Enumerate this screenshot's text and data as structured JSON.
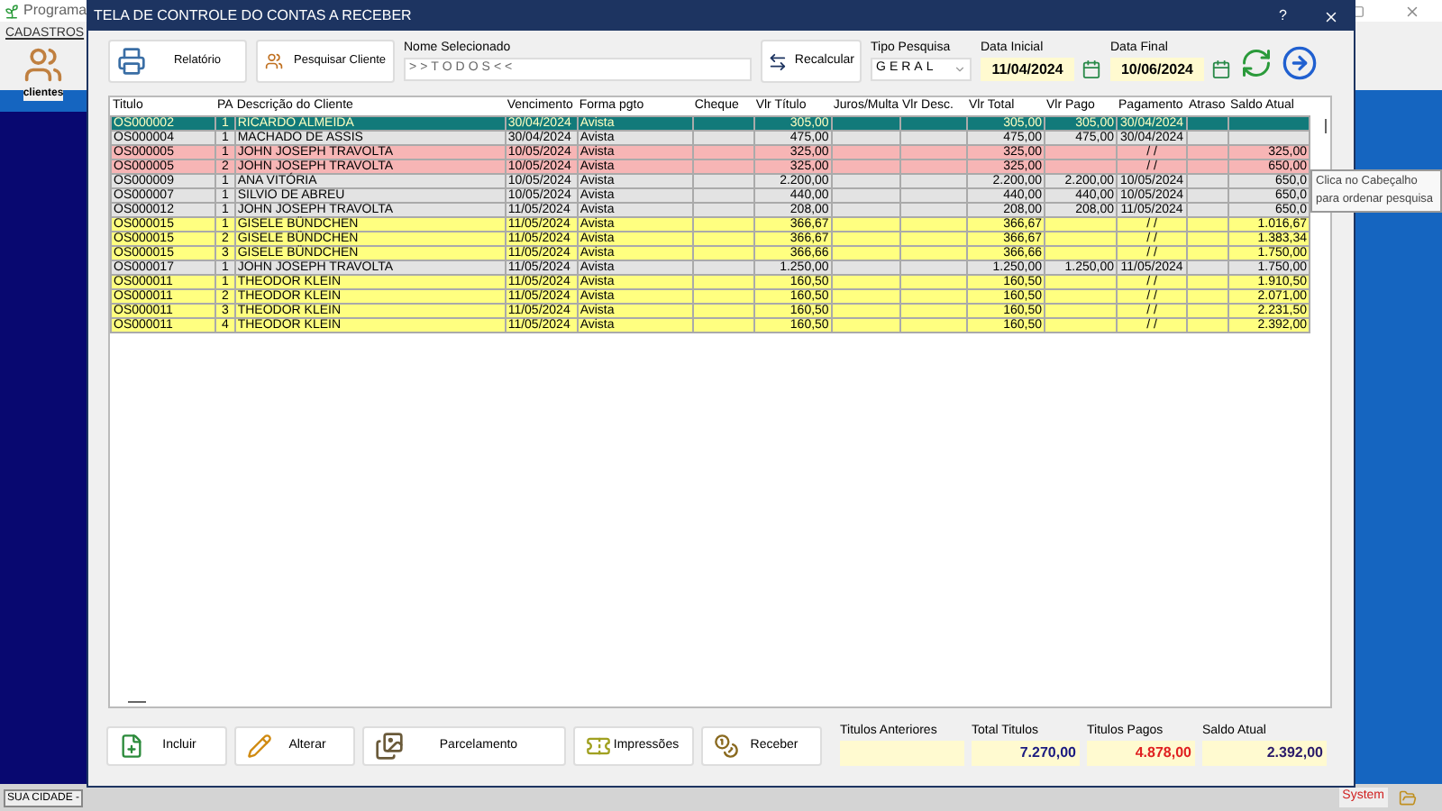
{
  "app": {
    "title": "Programa",
    "menu": [
      "CADASTROS"
    ],
    "launcher": {
      "label": "clientes"
    },
    "status_left": "SUA CIDADE -",
    "status_right": "System"
  },
  "dialog": {
    "title": "TELA DE CONTROLE DO CONTAS A RECEBER",
    "help": "?"
  },
  "toolbar": {
    "buttons": [
      {
        "label": "Relatório",
        "kind": "report"
      },
      {
        "label": "Pesquisar Cliente",
        "kind": "search"
      }
    ],
    "name_label": "Nome Selecionado",
    "name_value": ">>TODOS<<",
    "recalc": "Recalcular",
    "type_label": "Tipo Pesquisa",
    "type_value": "GERAL",
    "start_label": "Data Inicial",
    "start_value": "11/04/2024",
    "end_label": "Data Final",
    "end_value": "10/06/2024"
  },
  "table": {
    "columns": [
      "Titulo",
      "PA",
      "Descrição do Cliente",
      "Vencimento",
      "Forma pgto",
      "Cheque",
      "Vlr Título",
      "Juros/Multa",
      "Vlr Desc.",
      "Vlr Total",
      "Vlr Pago",
      "Pagamento",
      "Atraso",
      "Saldo Atual"
    ],
    "rows": [
      {
        "selected": true,
        "cells": [
          "OS000002",
          "1",
          "RICARDO ALMEIDA",
          "30/04/2024",
          "Avista",
          "",
          "305,00",
          "",
          "",
          "305,00",
          "305,00",
          "30/04/2024",
          "",
          ""
        ]
      },
      {
        "selected": false,
        "color": "#e3e3e3",
        "cells": [
          "OS000004",
          "1",
          "MACHADO DE ASSIS",
          "30/04/2024",
          "Avista",
          "",
          "475,00",
          "",
          "",
          "475,00",
          "475,00",
          "30/04/2024",
          "",
          ""
        ]
      },
      {
        "selected": false,
        "color": "#f7b5b5",
        "cells": [
          "OS000005",
          "1",
          "JOHN JOSEPH TRAVOLTA",
          "10/05/2024",
          "Avista",
          "",
          "325,00",
          "",
          "",
          "325,00",
          "",
          "/ /",
          "",
          "325,00"
        ]
      },
      {
        "selected": false,
        "color": "#f7b5b5",
        "cells": [
          "OS000005",
          "2",
          "JOHN JOSEPH TRAVOLTA",
          "10/05/2024",
          "Avista",
          "",
          "325,00",
          "",
          "",
          "325,00",
          "",
          "/ /",
          "",
          "650,00"
        ]
      },
      {
        "selected": false,
        "color": "#e3e3e3",
        "cells": [
          "OS000009",
          "1",
          "ANA VITÓRIA",
          "10/05/2024",
          "Avista",
          "",
          "2.200,00",
          "",
          "",
          "2.200,00",
          "2.200,00",
          "10/05/2024",
          "",
          "650,0"
        ]
      },
      {
        "selected": false,
        "color": "#e3e3e3",
        "cells": [
          "OS000007",
          "1",
          "SILVIO DE ABREU",
          "10/05/2024",
          "Avista",
          "",
          "440,00",
          "",
          "",
          "440,00",
          "440,00",
          "10/05/2024",
          "",
          "650,0"
        ]
      },
      {
        "selected": false,
        "color": "#e3e3e3",
        "cells": [
          "OS000012",
          "1",
          "JOHN JOSEPH TRAVOLTA",
          "11/05/2024",
          "Avista",
          "",
          "208,00",
          "",
          "",
          "208,00",
          "208,00",
          "11/05/2024",
          "",
          "650,0"
        ]
      },
      {
        "selected": false,
        "color": "#ffff80",
        "cells": [
          "OS000015",
          "1",
          "GISELE BÜNDCHEN",
          "11/05/2024",
          "Avista",
          "",
          "366,67",
          "",
          "",
          "366,67",
          "",
          "/ /",
          "",
          "1.016,67"
        ]
      },
      {
        "selected": false,
        "color": "#ffff80",
        "cells": [
          "OS000015",
          "2",
          "GISELE BÜNDCHEN",
          "11/05/2024",
          "Avista",
          "",
          "366,67",
          "",
          "",
          "366,67",
          "",
          "/ /",
          "",
          "1.383,34"
        ]
      },
      {
        "selected": false,
        "color": "#ffff80",
        "cells": [
          "OS000015",
          "3",
          "GISELE BÜNDCHEN",
          "11/05/2024",
          "Avista",
          "",
          "366,66",
          "",
          "",
          "366,66",
          "",
          "/ /",
          "",
          "1.750,00"
        ]
      },
      {
        "selected": false,
        "color": "#e3e3e3",
        "cells": [
          "OS000017",
          "1",
          "JOHN JOSEPH TRAVOLTA",
          "11/05/2024",
          "Avista",
          "",
          "1.250,00",
          "",
          "",
          "1.250,00",
          "1.250,00",
          "11/05/2024",
          "",
          "1.750,00"
        ]
      },
      {
        "selected": false,
        "color": "#ffff80",
        "cells": [
          "OS000011",
          "1",
          "THEODOR KLEIN",
          "11/05/2024",
          "Avista",
          "",
          "160,50",
          "",
          "",
          "160,50",
          "",
          "/ /",
          "",
          "1.910,50"
        ]
      },
      {
        "selected": false,
        "color": "#ffff80",
        "cells": [
          "OS000011",
          "2",
          "THEODOR KLEIN",
          "11/05/2024",
          "Avista",
          "",
          "160,50",
          "",
          "",
          "160,50",
          "",
          "/ /",
          "",
          "2.071,00"
        ]
      },
      {
        "selected": false,
        "color": "#ffff80",
        "cells": [
          "OS000011",
          "3",
          "THEODOR KLEIN",
          "11/05/2024",
          "Avista",
          "",
          "160,50",
          "",
          "",
          "160,50",
          "",
          "/ /",
          "",
          "2.231,50"
        ]
      },
      {
        "selected": false,
        "color": "#ffff80",
        "cells": [
          "OS000011",
          "4",
          "THEODOR KLEIN",
          "11/05/2024",
          "Avista",
          "",
          "160,50",
          "",
          "",
          "160,50",
          "",
          "/ /",
          "",
          "2.392,00"
        ]
      }
    ]
  },
  "tooltip": [
    "Clica no Cabeçalho",
    "para ordenar pesquisa"
  ],
  "actions": [
    {
      "label": "Incluir",
      "kind": "add"
    },
    {
      "label": "Alterar",
      "kind": "edit"
    },
    {
      "label": "Parcelamento",
      "kind": "installments"
    },
    {
      "label": "Impressões",
      "kind": "print"
    },
    {
      "label": "Receber",
      "kind": "receive"
    }
  ],
  "summary": [
    {
      "label": "Titulos Anteriores"
    },
    {
      "label": "Total Titulos",
      "value": "7.270,00",
      "color": "#1a1a80"
    },
    {
      "label": "Titulos Pagos",
      "value": "4.878,00",
      "color": "#e02020"
    },
    {
      "label": "Saldo Atual",
      "value": "2.392,00",
      "color": "#2a1a6a"
    }
  ]
}
